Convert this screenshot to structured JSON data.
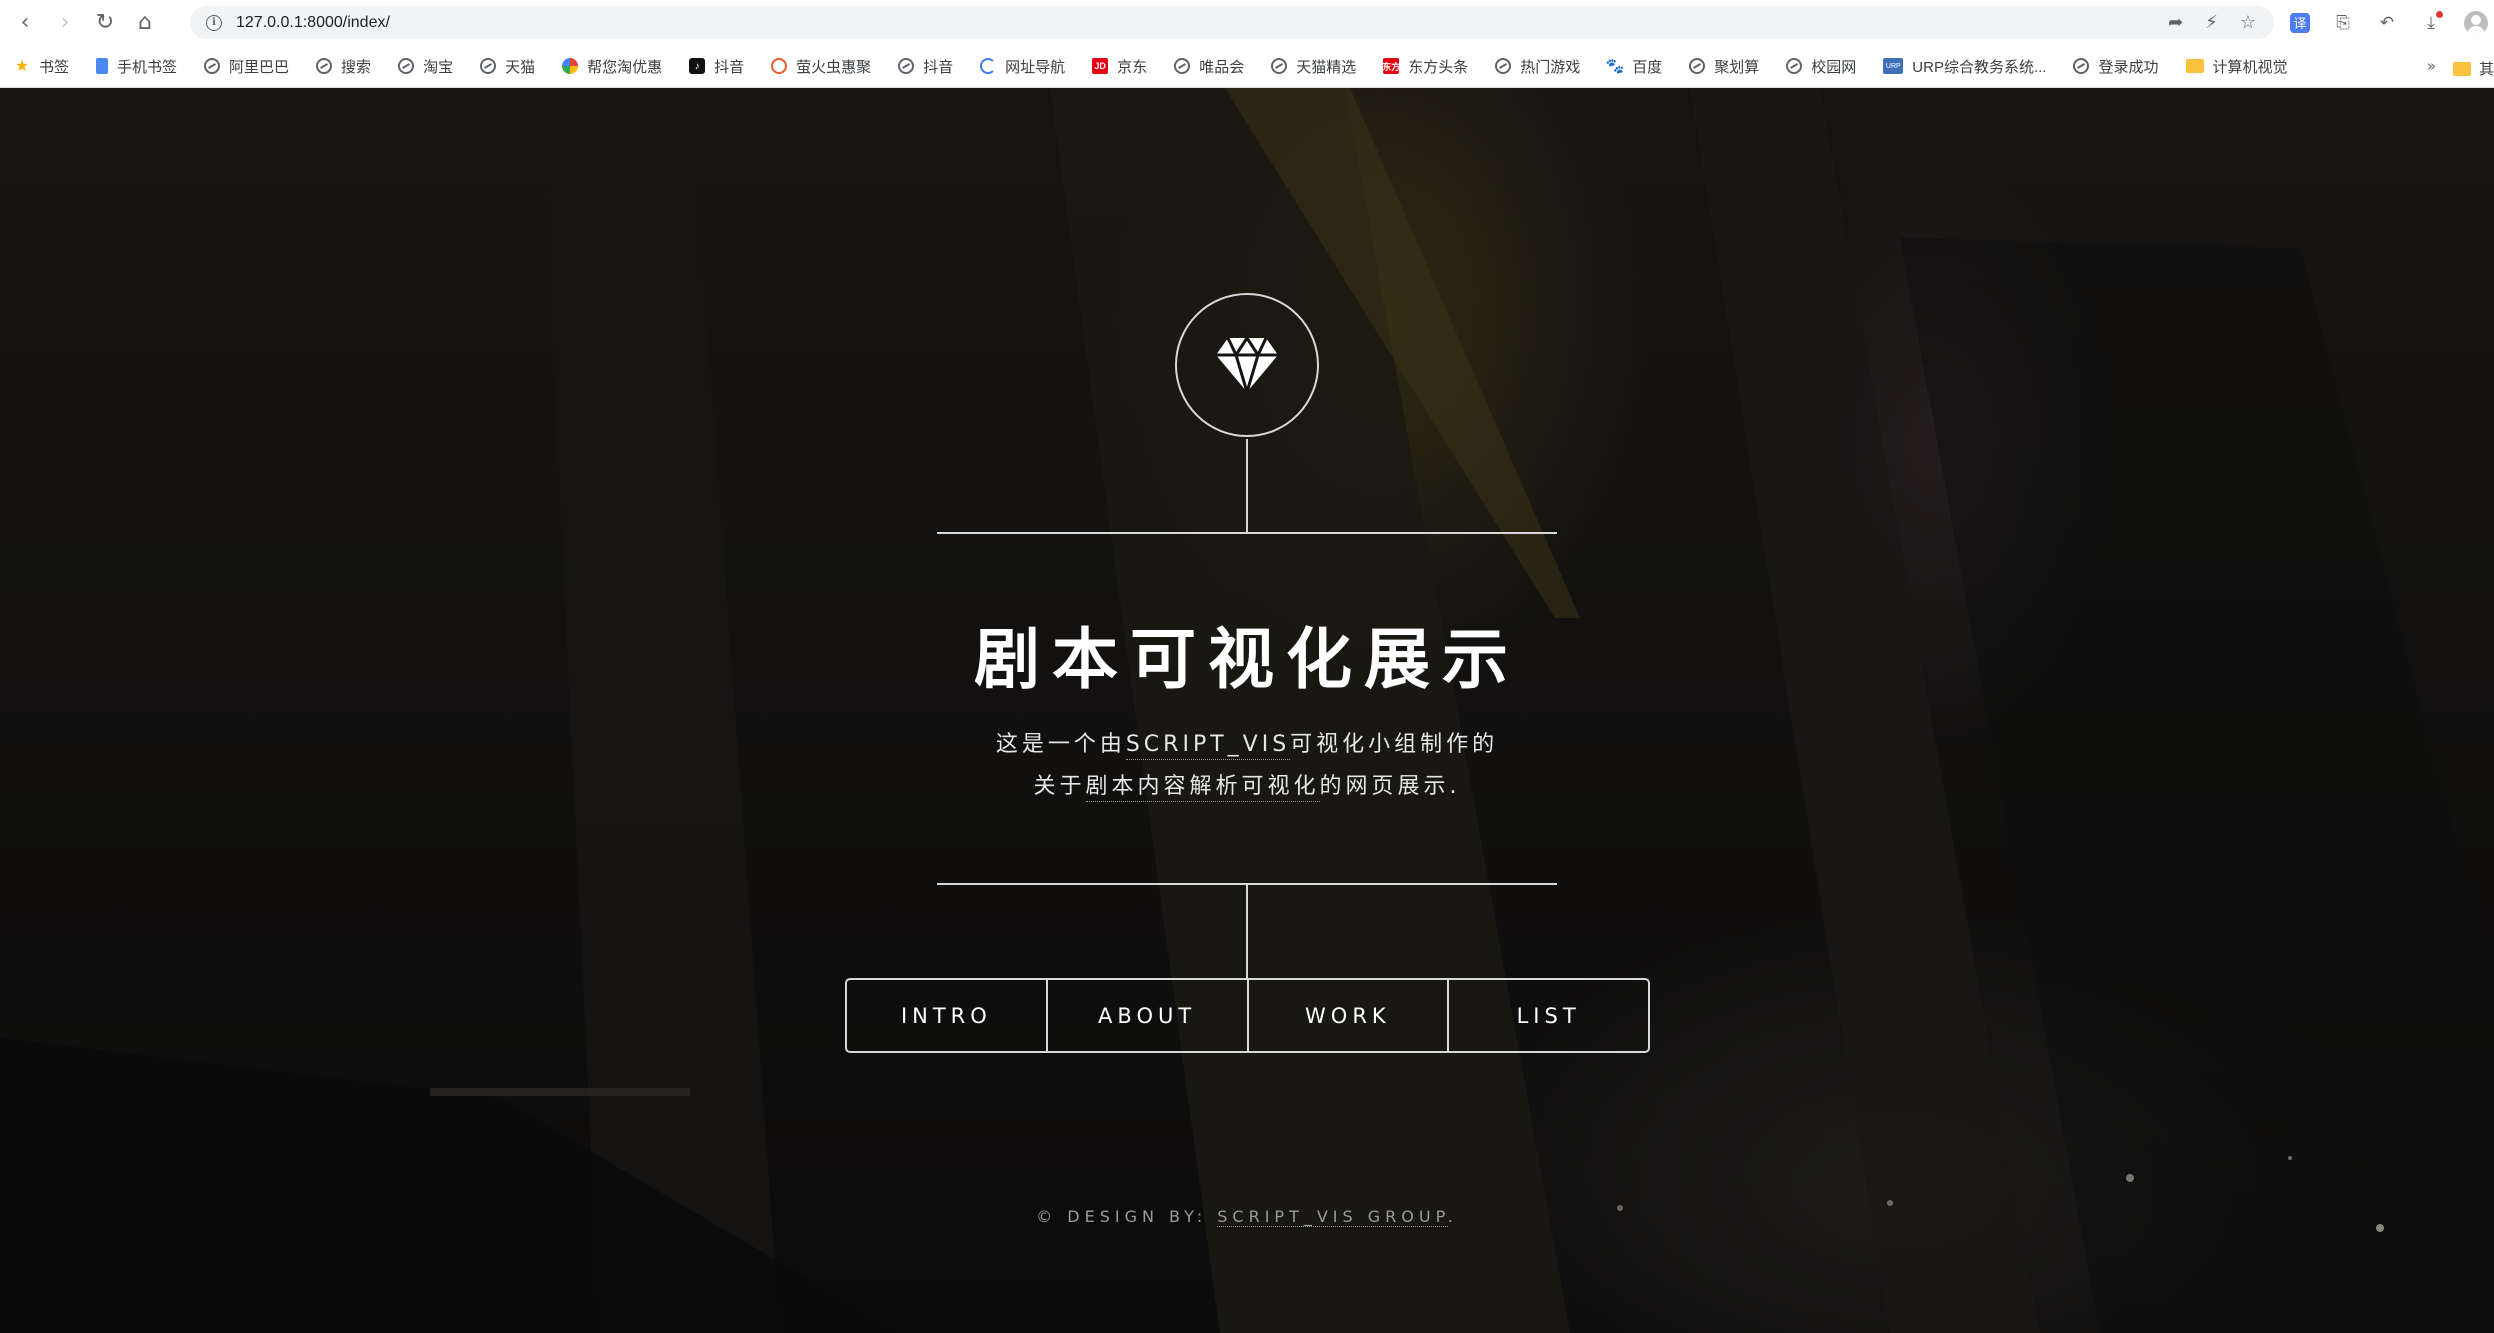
{
  "browser": {
    "url": "127.0.0.1:8000/index/",
    "bookmarks": [
      {
        "label": "书签",
        "icon": "star-icon"
      },
      {
        "label": "手机书签",
        "icon": "doc-icon"
      },
      {
        "label": "阿里巴巴",
        "icon": "globe-icon"
      },
      {
        "label": "搜索",
        "icon": "globe-icon"
      },
      {
        "label": "淘宝",
        "icon": "globe-icon"
      },
      {
        "label": "天猫",
        "icon": "globe-icon"
      },
      {
        "label": "帮您淘优惠",
        "icon": "color-icon"
      },
      {
        "label": "抖音",
        "icon": "tiktok-icon"
      },
      {
        "label": "萤火虫惠聚",
        "icon": "ring-icon"
      },
      {
        "label": "抖音",
        "icon": "globe-icon"
      },
      {
        "label": "网址导航",
        "icon": "swirl-icon"
      },
      {
        "label": "京东",
        "icon": "jd-icon"
      },
      {
        "label": "唯品会",
        "icon": "globe-icon"
      },
      {
        "label": "天猫精选",
        "icon": "globe-icon"
      },
      {
        "label": "东方头条",
        "icon": "news-icon"
      },
      {
        "label": "热门游戏",
        "icon": "globe-icon"
      },
      {
        "label": "百度",
        "icon": "paw-icon"
      },
      {
        "label": "聚划算",
        "icon": "globe-icon"
      },
      {
        "label": "校园网",
        "icon": "globe-icon"
      },
      {
        "label": "URP综合教务系统...",
        "icon": "urp-icon"
      },
      {
        "label": "登录成功",
        "icon": "globe-icon"
      },
      {
        "label": "计算机视觉",
        "icon": "folder-icon"
      }
    ],
    "more_label": "»",
    "last_folder_label": "其"
  },
  "hero": {
    "title": "剧本可视化展示",
    "desc_line1_a": "这是一个由",
    "desc_line1_b": "SCRIPT_VIS",
    "desc_line1_c": "可视化小组制作的",
    "desc_line2_a": "关于",
    "desc_line2_b": "剧本内容解析可视化",
    "desc_line2_c": "的网页展示."
  },
  "nav": [
    "INTRO",
    "ABOUT",
    "WORK",
    "LIST"
  ],
  "footer": {
    "prefix": "© DESIGN BY: ",
    "link": "SCRIPT_VIS GROUP",
    "suffix": "."
  },
  "colors": {
    "line": "#d8d8d8",
    "title": "#ffffff",
    "footer": "#9b9b9b"
  }
}
